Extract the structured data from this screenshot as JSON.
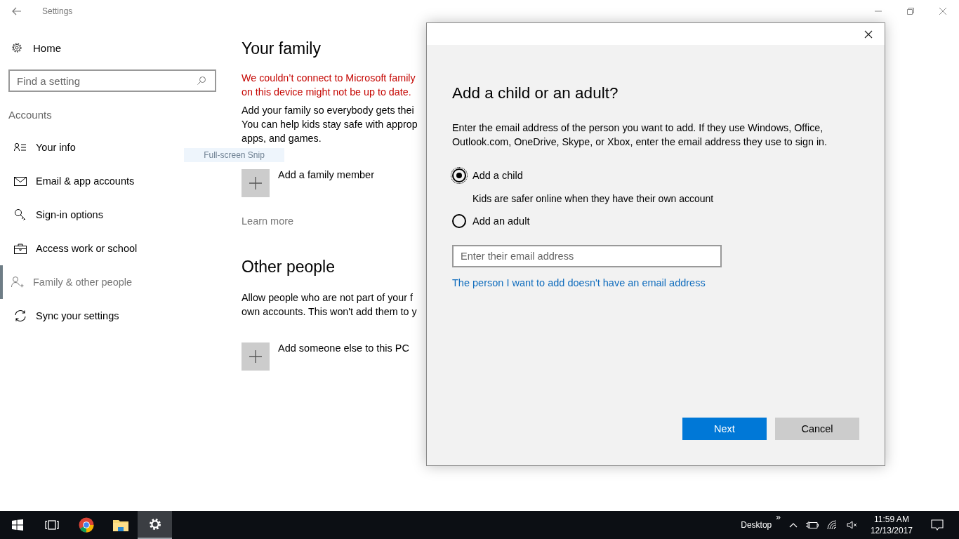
{
  "window": {
    "title": "Settings"
  },
  "sidebar": {
    "home": "Home",
    "search": {
      "placeholder": "Find a setting"
    },
    "section": "Accounts",
    "items": [
      {
        "label": "Your info",
        "selected": false
      },
      {
        "label": "Email & app accounts",
        "selected": false
      },
      {
        "label": "Sign-in options",
        "selected": false
      },
      {
        "label": "Access work or school",
        "selected": false
      },
      {
        "label": "Family & other people",
        "selected": true
      },
      {
        "label": "Sync your settings",
        "selected": false
      }
    ]
  },
  "content": {
    "family_heading": "Your family",
    "error_lines": [
      "We couldn’t connect to Microsoft family",
      "on this device might not be up to date."
    ],
    "family_lines": [
      "Add your family so everybody gets thei",
      "You can help kids stay safe with approp",
      "apps, and games."
    ],
    "add_family": "Add a family member",
    "learn_more": "Learn more",
    "other_heading": "Other people",
    "other_lines": [
      "Allow people who are not part of your f",
      "own accounts. This won't add them to y"
    ],
    "add_other": "Add someone else to this PC"
  },
  "tooltip": "Full-screen Snip",
  "dialog": {
    "title": "Add a child or an adult?",
    "intro": "Enter the email address of the person you want to add. If they use Windows, Office, Outlook.com, OneDrive, Skype, or Xbox, enter the email address they use to sign in.",
    "options": [
      {
        "label": "Add a child",
        "selected": true,
        "note": "Kids are safer online when they have their own account"
      },
      {
        "label": "Add an adult",
        "selected": false
      }
    ],
    "email": {
      "placeholder": "Enter their email address"
    },
    "no_email_link": "The person I want to add doesn't have an email address",
    "next": "Next",
    "cancel": "Cancel"
  },
  "taskbar": {
    "apps": [
      {
        "selected": false
      },
      {
        "selected": false
      },
      {
        "selected": false
      },
      {
        "selected": false
      },
      {
        "selected": true
      }
    ],
    "desktop": "Desktop",
    "chevron": "»",
    "time": "11:59 AM",
    "date": "12/13/2017"
  }
}
